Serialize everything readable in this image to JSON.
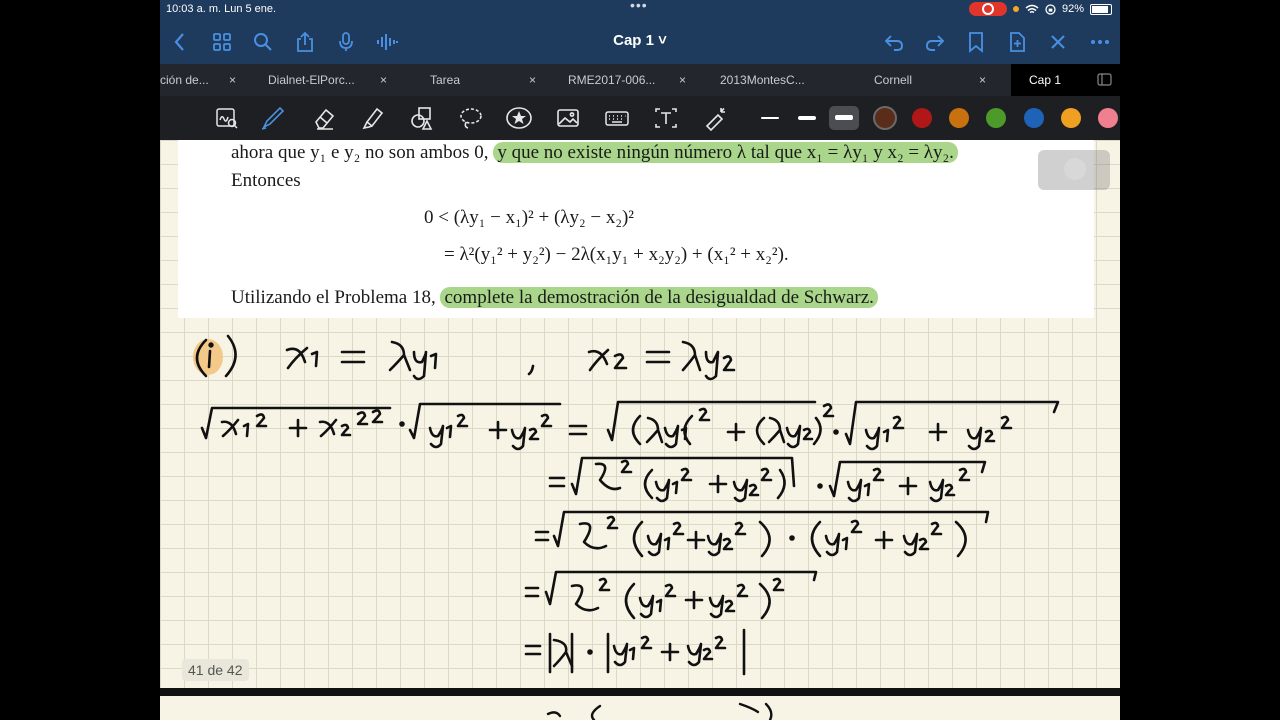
{
  "status_bar": {
    "time": "10:03 a. m.  Lun 5 ene.",
    "battery": "92%"
  },
  "header": {
    "title": "Cap 1 ˅"
  },
  "tabs": [
    {
      "label": "ción de..."
    },
    {
      "label": "Dialnet-ElPorc..."
    },
    {
      "label": "Tarea"
    },
    {
      "label": "RME2017-006..."
    },
    {
      "label": "2013MontesC..."
    },
    {
      "label": "Cornell"
    },
    {
      "label": "Cap 1"
    }
  ],
  "tab_close_glyph": "×",
  "toolbar": {
    "tools": [
      "lasso-ocr-icon",
      "pen-icon",
      "eraser-icon",
      "highlighter-icon",
      "shapes-icon",
      "lasso-icon",
      "star-icon",
      "image-icon",
      "keyboard-icon",
      "text-icon",
      "laser-icon"
    ],
    "colors": [
      "#5a2d1a",
      "#b01818",
      "#c8720f",
      "#4c9a2a",
      "#1e63b8",
      "#f0a020",
      "#f08090"
    ]
  },
  "book": {
    "line1_plain": "ahora que y₁ e y₂ no son ambos 0,",
    "line1_highlight": "y que no existe ningún número λ tal que x₁ = λy₁ y x₂ = λy₂.",
    "line2": "Entonces",
    "eq1": "0 < (λy₁ − x₁)² + (λy₂ − x₂)²",
    "eq2": "= λ²(y₁² + y₂²) − 2λ(x₁y₁ + x₂y₂) + (x₁² + x₂²).",
    "line3_plain": "Utilizando el Problema 18,",
    "line3_highlight": "complete la demostración de la desigualdad de Schwarz."
  },
  "page_indicator": "41 de 42"
}
